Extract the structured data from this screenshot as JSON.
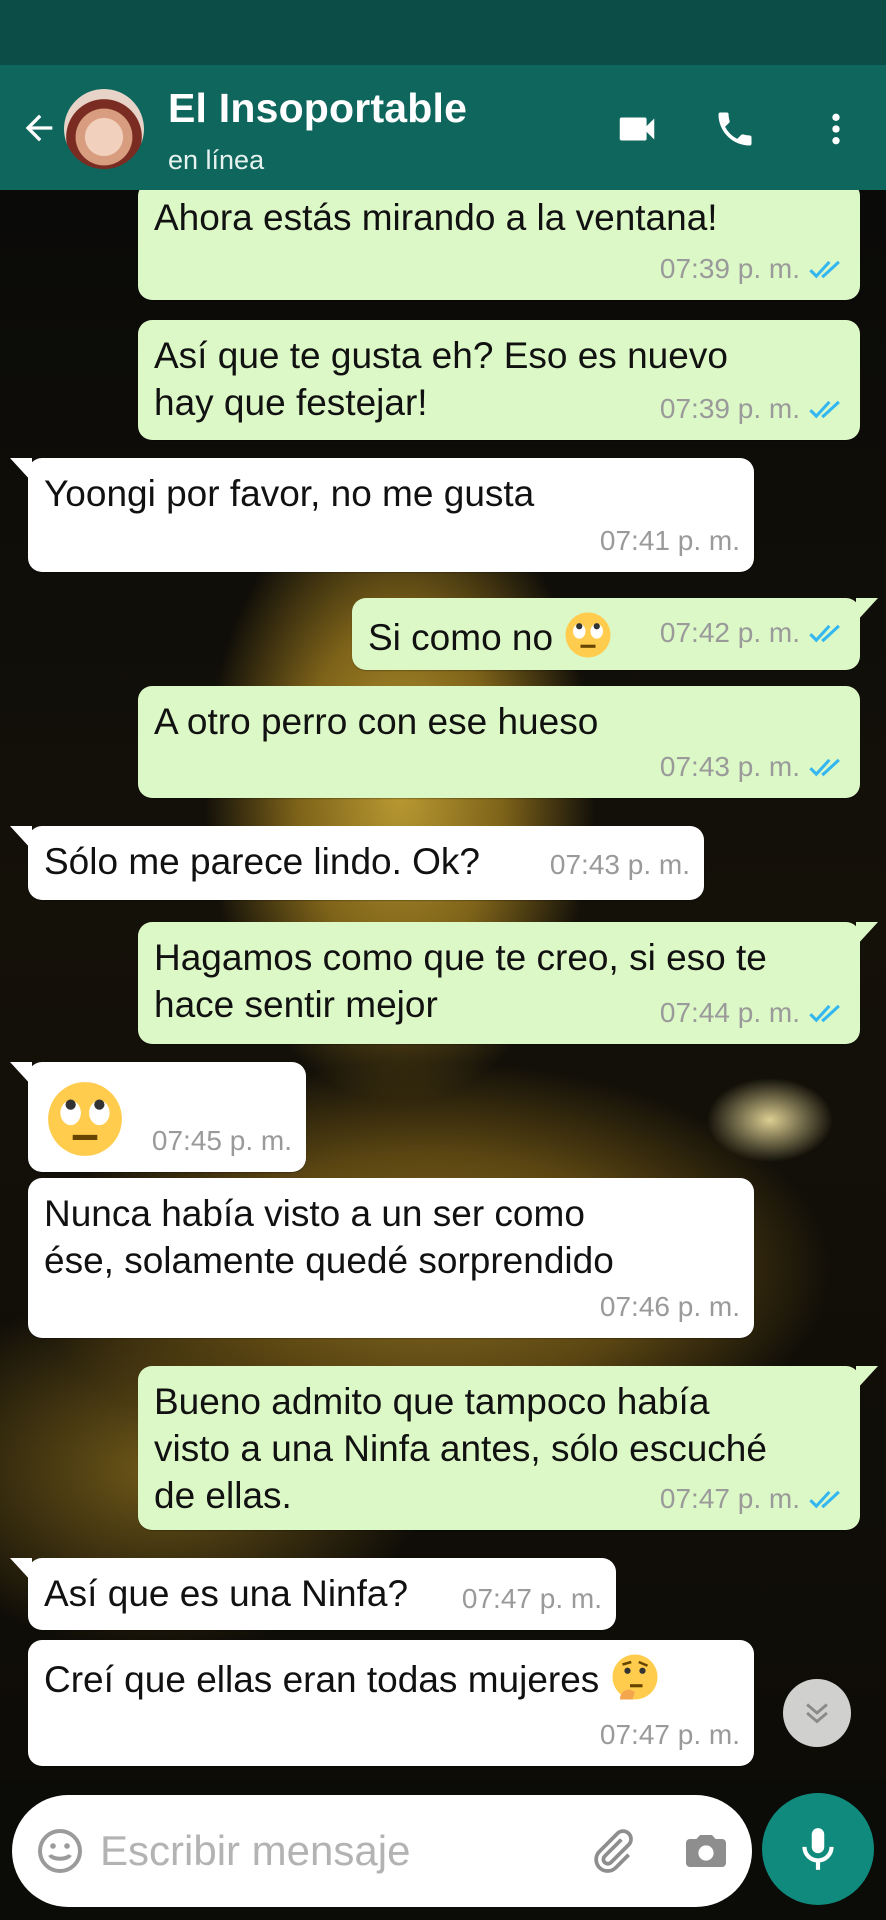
{
  "header": {
    "contact_name": "El Insoportable",
    "status": "en línea"
  },
  "icons": {
    "back": "arrow-left-icon",
    "video": "video-camera-icon",
    "call": "phone-icon",
    "menu": "more-vertical-icon",
    "emoji": "smiley-icon",
    "attach": "paperclip-icon",
    "camera": "camera-icon",
    "mic": "microphone-icon",
    "scroll": "double-chevron-down-icon"
  },
  "colors": {
    "header": "#0f665c",
    "statusbar": "#0d4d47",
    "outgoing_bubble": "#dcf8c6",
    "incoming_bubble": "#ffffff",
    "read_ticks": "#34b7f1",
    "mic_button": "#0f8a7c"
  },
  "messages": [
    {
      "direction": "out",
      "text": "Ahora estás mirando a la ventana!",
      "time": "07:39 p. m.",
      "ticks": "read"
    },
    {
      "direction": "out",
      "text": "Así que te gusta eh? Eso es nuevo\nhay que festejar!",
      "time": "07:39 p. m.",
      "ticks": "read"
    },
    {
      "direction": "in",
      "text": "Yoongi por favor, no me gusta",
      "time": "07:41 p. m."
    },
    {
      "direction": "out",
      "text": "Si como no",
      "emoji": "face-with-rolling-eyes",
      "time": "07:42 p. m.",
      "ticks": "read"
    },
    {
      "direction": "out",
      "text": "A otro perro con ese hueso",
      "time": "07:43 p. m.",
      "ticks": "read"
    },
    {
      "direction": "in",
      "text": "Sólo me parece lindo. Ok?",
      "time": "07:43 p. m."
    },
    {
      "direction": "out",
      "text": "Hagamos como que te creo, si eso te\nhace sentir mejor",
      "time": "07:44 p. m.",
      "ticks": "read"
    },
    {
      "direction": "in",
      "text": "",
      "emoji": "face-with-rolling-eyes",
      "time": "07:45 p. m."
    },
    {
      "direction": "in",
      "text": "Nunca había visto a un ser como\nése, solamente quedé sorprendido",
      "time": "07:46 p. m."
    },
    {
      "direction": "out",
      "text": "Bueno admito que tampoco había\nvisto a una Ninfa antes, sólo escuché\nde ellas.",
      "time": "07:47 p. m.",
      "ticks": "read"
    },
    {
      "direction": "in",
      "text": "Así que es una Ninfa?",
      "time": "07:47 p. m."
    },
    {
      "direction": "in",
      "text": "Creí que ellas eran todas mujeres",
      "emoji": "thinking-face",
      "time": "07:47 p. m."
    }
  ],
  "composer": {
    "placeholder": "Escribir mensaje"
  }
}
